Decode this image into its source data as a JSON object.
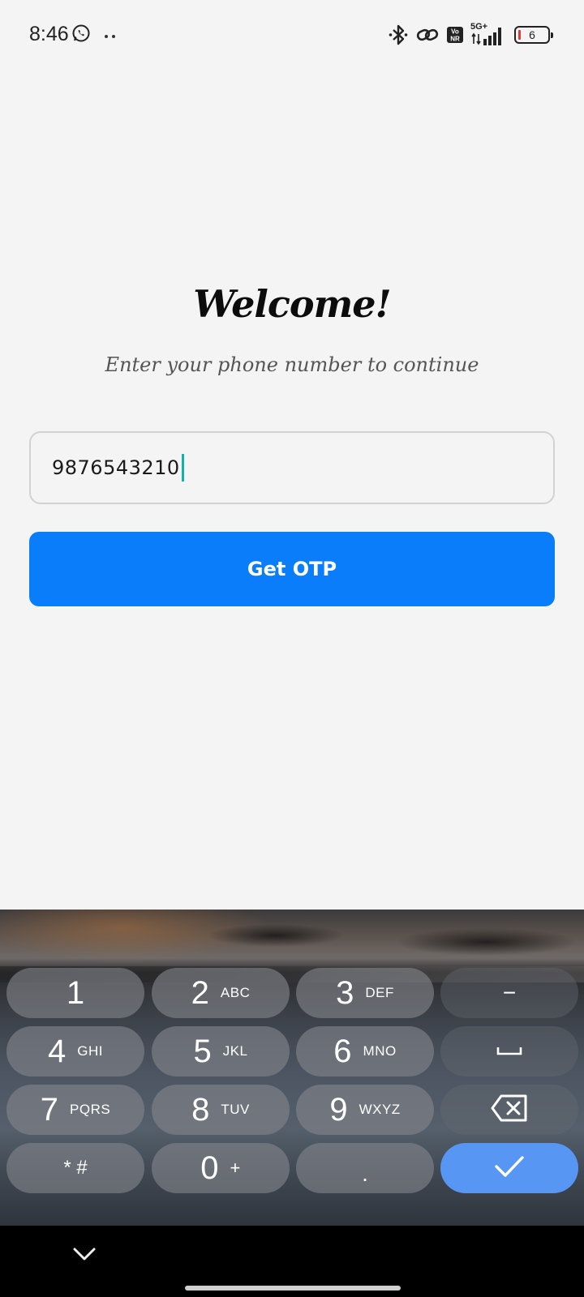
{
  "status_bar": {
    "time": "8:46",
    "network_label": "5G+",
    "battery_level": "6",
    "icons": [
      "whatsapp-icon",
      "more-dots-icon",
      "bluetooth-icon",
      "link-icon",
      "vonr-icon",
      "signal-icon",
      "battery-icon"
    ]
  },
  "main": {
    "title": "Welcome!",
    "subtitle": "Enter your phone number to continue",
    "phone_input_value": "9876543210",
    "otp_button_label": "Get OTP"
  },
  "keyboard": {
    "keys": [
      {
        "digit": "1",
        "letters": ""
      },
      {
        "digit": "2",
        "letters": "ABC"
      },
      {
        "digit": "3",
        "letters": "DEF"
      },
      {
        "digit": "4",
        "letters": "GHI"
      },
      {
        "digit": "5",
        "letters": "JKL"
      },
      {
        "digit": "6",
        "letters": "MNO"
      },
      {
        "digit": "7",
        "letters": "PQRS"
      },
      {
        "digit": "8",
        "letters": "TUV"
      },
      {
        "digit": "9",
        "letters": "WXYZ"
      },
      {
        "digit": "0",
        "letters": "+"
      }
    ],
    "symbols_label": "* #",
    "period_label": ".",
    "minus_label": "−",
    "done_color": "#5896f3"
  },
  "colors": {
    "accent": "#0a7dfb",
    "caret": "#12b3a1",
    "background": "#f4f4f4"
  }
}
